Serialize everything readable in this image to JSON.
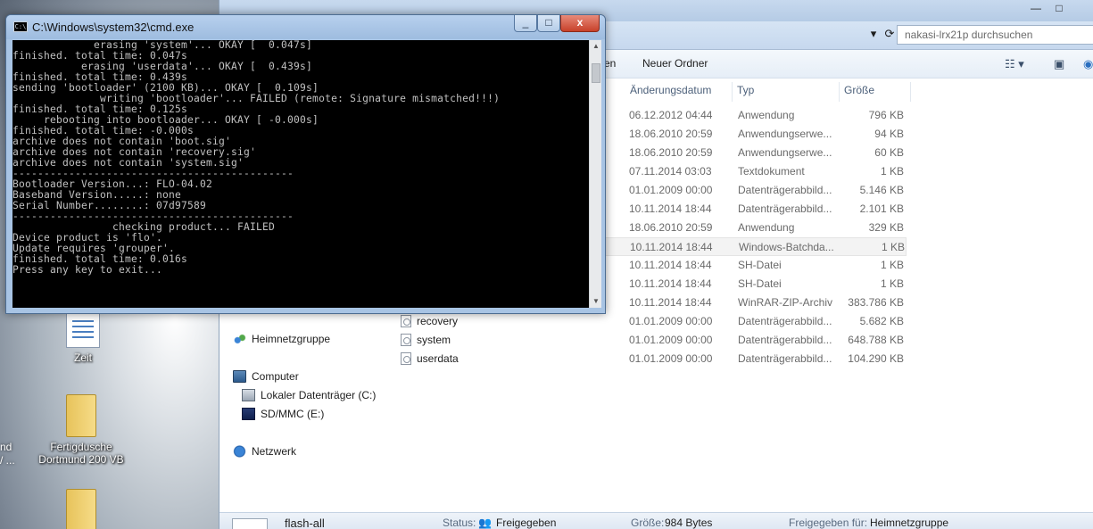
{
  "cmd": {
    "title": "C:\\Windows\\system32\\cmd.exe",
    "controls": {
      "minimize": "_",
      "maximize": "□",
      "close": "x"
    },
    "lines": [
      "             erasing 'system'... OKAY [  0.047s]",
      "finished. total time: 0.047s",
      "           erasing 'userdata'... OKAY [  0.439s]",
      "finished. total time: 0.439s",
      "sending 'bootloader' (2100 KB)... OKAY [  0.109s]",
      "              writing 'bootloader'... FAILED (remote: Signature mismatched!!!)",
      "finished. total time: 0.125s",
      "     rebooting into bootloader... OKAY [ -0.000s]",
      "finished. total time: -0.000s",
      "archive does not contain 'boot.sig'",
      "archive does not contain 'recovery.sig'",
      "archive does not contain 'system.sig'",
      "---------------------------------------------",
      "Bootloader Version...: FLO-04.02",
      "Baseband Version.....: none",
      "Serial Number........: 07d97589",
      "---------------------------------------------",
      "                checking product... FAILED",
      "",
      "Device product is 'flo'.",
      "Update requires 'grouper'.",
      "",
      "finished. total time: 0.016s",
      "Press any key to exit..."
    ]
  },
  "explorer": {
    "window_controls": {
      "minimize": "—",
      "restore": "□"
    },
    "search_placeholder": "nakasi-lrx21p durchsuchen",
    "toolbar": {
      "partial_label": "en",
      "new_folder": "Neuer Ordner"
    },
    "columns": {
      "date": "Änderungsdatum",
      "type": "Typ",
      "size": "Größe"
    },
    "rows": [
      {
        "name": "",
        "date": "06.12.2012 04:44",
        "type": "Anwendung",
        "size": "796 KB"
      },
      {
        "name": "",
        "date": "18.06.2010 20:59",
        "type": "Anwendungserwe...",
        "size": "94 KB"
      },
      {
        "name": "",
        "date": "18.06.2010 20:59",
        "type": "Anwendungserwe...",
        "size": "60 KB"
      },
      {
        "name": "",
        "date": "07.11.2014 03:03",
        "type": "Textdokument",
        "size": "1 KB"
      },
      {
        "name": "",
        "date": "01.01.2009 00:00",
        "type": "Datenträgerabbild...",
        "size": "5.146 KB"
      },
      {
        "name": "",
        "date": "10.11.2014 18:44",
        "type": "Datenträgerabbild...",
        "size": "2.101 KB"
      },
      {
        "name": "",
        "date": "18.06.2010 20:59",
        "type": "Anwendung",
        "size": "329 KB"
      },
      {
        "name": "",
        "date": "10.11.2014 18:44",
        "type": "Windows-Batchda...",
        "size": "1 KB"
      },
      {
        "name": "",
        "date": "10.11.2014 18:44",
        "type": "SH-Datei",
        "size": "1 KB"
      },
      {
        "name": "",
        "date": "10.11.2014 18:44",
        "type": "SH-Datei",
        "size": "1 KB"
      },
      {
        "name": "",
        "date": "10.11.2014 18:44",
        "type": "WinRAR-ZIP-Archiv",
        "size": "383.786 KB"
      },
      {
        "name": "recovery",
        "date": "01.01.2009 00:00",
        "type": "Datenträgerabbild...",
        "size": "5.682 KB"
      },
      {
        "name": "system",
        "date": "01.01.2009 00:00",
        "type": "Datenträgerabbild...",
        "size": "648.788 KB"
      },
      {
        "name": "userdata",
        "date": "01.01.2009 00:00",
        "type": "Datenträgerabbild...",
        "size": "104.290 KB"
      }
    ],
    "nav": {
      "homegroup": "Heimnetzgruppe",
      "computer": "Computer",
      "local_disk": "Lokaler Datenträger (C:)",
      "sd": "SD/MMC (E:)",
      "network": "Netzwerk"
    },
    "details": {
      "file_name": "flash-all",
      "status_label": "Status:",
      "status_value": "Freigegeben",
      "size_label": "Größe:",
      "size_value": "984 Bytes",
      "shared_label": "Freigegeben für:",
      "shared_value": "Heimnetzgruppe"
    }
  },
  "desktop": {
    "icons": [
      {
        "label": "Zeit"
      },
      {
        "label": "Fertigdusche Dortmund 200 VB"
      }
    ],
    "clipped_labels": [
      "nd",
      "/ ..."
    ]
  }
}
